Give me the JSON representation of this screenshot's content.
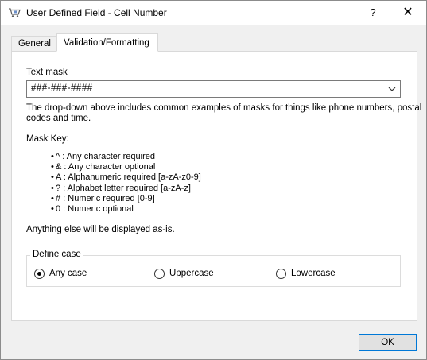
{
  "window": {
    "title": "User Defined Field - Cell Number",
    "app_icon": "cart-icon",
    "help_label": "?",
    "close_label": "✕"
  },
  "tabs": [
    {
      "label": "General",
      "selected": false
    },
    {
      "label": "Validation/Formatting",
      "selected": true
    }
  ],
  "validation": {
    "text_mask_label": "Text mask",
    "text_mask_value": "###-###-####",
    "description_line1": "The drop-down above includes common examples of masks for things like phone numbers, postal",
    "description_line2": "codes and time.",
    "mask_key_label": "Mask Key:",
    "mask_keys": [
      "^ : Any character required",
      "& : Any character optional",
      "A : Alphanumeric required [a-zA-z0-9]",
      "? : Alphabet letter required [a-zA-z]",
      "# : Numeric required [0-9]",
      "0 : Numeric optional"
    ],
    "note": "Anything else will be displayed as-is."
  },
  "define_case": {
    "legend": "Define case",
    "options": [
      {
        "label": "Any case",
        "checked": true
      },
      {
        "label": "Uppercase",
        "checked": false
      },
      {
        "label": "Lowercase",
        "checked": false
      }
    ]
  },
  "buttons": {
    "ok_label": "OK"
  }
}
